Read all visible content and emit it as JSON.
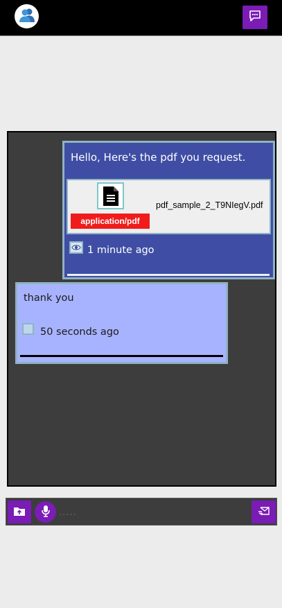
{
  "header": {
    "avatar_icon": "users-icon",
    "chat_button_icon": "chat-bubble-icon",
    "accent_color": "#7a1cb5"
  },
  "messages": [
    {
      "direction": "sent",
      "text": "Hello, Here's the pdf you request.",
      "attachment": {
        "icon": "document-icon",
        "mime_type": "application/pdf",
        "file_name": "pdf_sample_2_T9NIegV.pdf"
      },
      "status_icon": "eye-icon",
      "time": "1 minute ago",
      "bg_color": "#3f4ea4"
    },
    {
      "direction": "received",
      "text": "thank you",
      "status_icon": "checkbox-icon",
      "time": "50 seconds ago",
      "bg_color": "#a8b3ff"
    }
  ],
  "composer": {
    "folder_icon": "folder-upload-icon",
    "mic_icon": "microphone-icon",
    "placeholder": ".....",
    "value": "",
    "send_icon": "send-mail-icon"
  }
}
